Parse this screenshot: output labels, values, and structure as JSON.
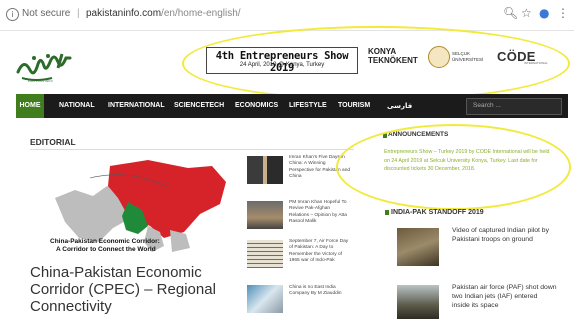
{
  "browser": {
    "security_text": "Not secure",
    "separator": "|",
    "url_host": "pakistaninfo.com",
    "url_path": "/en/home-english/",
    "icons": [
      "info-icon",
      "zoom-icon",
      "star-icon",
      "profile-icon",
      "menu-icon"
    ]
  },
  "logo": {
    "tagline": "PAKISTAN INFO"
  },
  "banner": {
    "title": "4th Entrepreneurs Show 2019",
    "subtitle": "24 April, 2019 @ Konya, Turkey",
    "konya_line1": "KONYA",
    "konya_line2": "TEKNÖKENT",
    "selcuk_line1": "SELÇUK",
    "selcuk_line2": "ÜNİVERSİTESİ",
    "code": "CÖDE",
    "code_sub": "INTERNATIONAL"
  },
  "nav": {
    "items": [
      "HOME",
      "NATIONAL",
      "INTERNATIONAL",
      "SCIENCETECH",
      "ECONOMICS",
      "LIFESTYLE",
      "TOURISM",
      "فارسی"
    ],
    "search_placeholder": "Search ..."
  },
  "editorial": {
    "heading": "EDITORIAL",
    "map_caption_1": "China-Pakistan Economic Corridor:",
    "map_caption_2": "A Corridor to Connect the World",
    "headline": "China-Pakistan Economic Corridor (CPEC) – Regional Connectivity"
  },
  "side_news": [
    {
      "text": "Imran Khan's Five Days in China: A Winning Perspective for Pakistan and China"
    },
    {
      "text": "PM Imran Khan Hopeful To Revive Pak-Afghan Relations – Opinion by Atta Rasool Malik"
    },
    {
      "text": "September 7, Air Force Day of Pakistan: A Day to Remember the Victory of 1965 war of Indo-Pak"
    },
    {
      "text": "China is no East India Company By M Ziauddin"
    }
  ],
  "announcements": {
    "heading": "ANNOUNCEMENTS",
    "body": "Entrepreneurs Show – Turkey 2019 by CODE International will be held on 24 April 2019 at Selcuk University Konya, Turkey. Last date for discounted tickets 30 December, 2018."
  },
  "standoff": {
    "heading": "INDIA-PAK STANDOFF 2019",
    "items": [
      {
        "text": "Video of captured Indian pilot by Pakistani troops on ground"
      },
      {
        "text": "Pakistan air force (PAF) shot down two Indian jets (IAF) entered inside its space"
      }
    ]
  },
  "colors": {
    "nav_bg": "#1b1b1b",
    "nav_active": "#3f7d1d",
    "announcement_text": "#8caf2e",
    "highlight_ellipse": "#f2ea3a"
  }
}
